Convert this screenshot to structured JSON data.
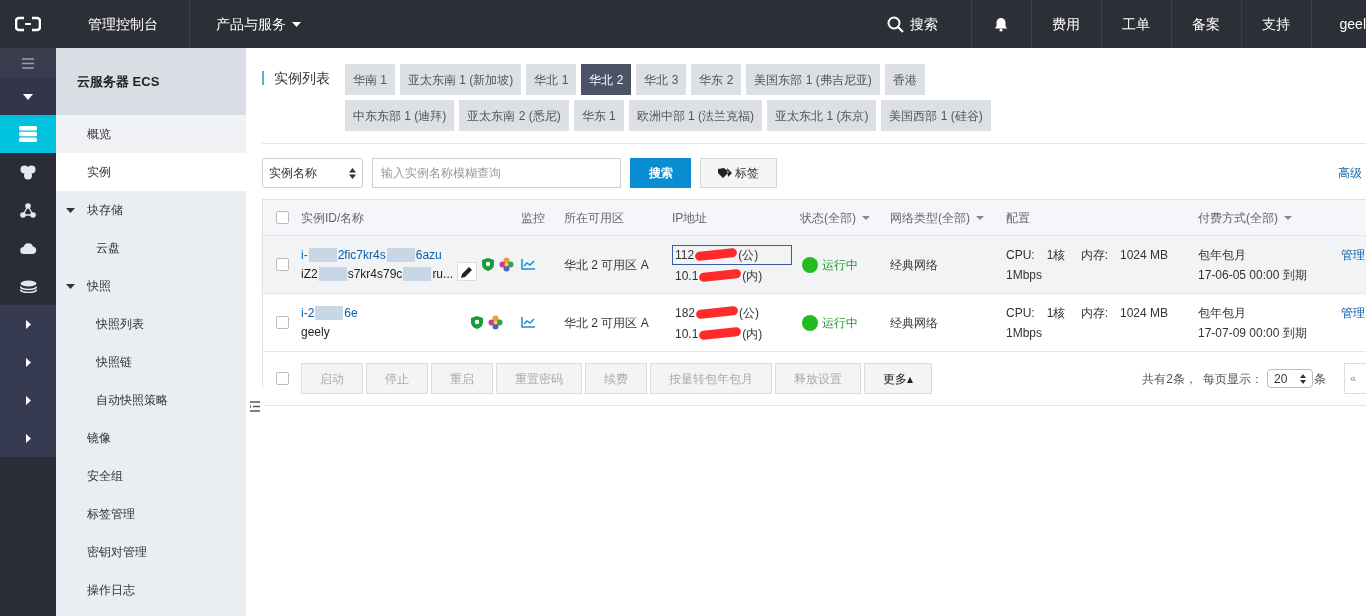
{
  "topbar": {
    "console": "管理控制台",
    "products": "产品与服务",
    "search": "搜索",
    "links": [
      "费用",
      "工单",
      "备案",
      "支持"
    ],
    "user": "geel"
  },
  "rail": {
    "items": [
      {
        "kind": "menu",
        "selected": false
      },
      {
        "kind": "collapse",
        "selected": false
      },
      {
        "kind": "servers",
        "selected": true
      },
      {
        "kind": "cluster",
        "selected": false
      },
      {
        "kind": "network",
        "selected": false
      },
      {
        "kind": "cloud",
        "selected": false
      },
      {
        "kind": "layers",
        "selected": false
      },
      {
        "kind": "expand",
        "selected": false
      },
      {
        "kind": "expand",
        "selected": false
      },
      {
        "kind": "expand",
        "selected": false
      },
      {
        "kind": "expand",
        "selected": false
      }
    ]
  },
  "sidebar": {
    "title": "云服务器 ECS",
    "items": [
      {
        "label": "概览",
        "selected": false
      },
      {
        "label": "实例",
        "selected": true
      },
      {
        "label": "块存储",
        "selected": false,
        "expanded": true,
        "children": [
          {
            "label": "云盘",
            "selected": false
          }
        ]
      },
      {
        "label": "快照",
        "selected": false,
        "expanded": true,
        "children": [
          {
            "label": "快照列表",
            "selected": false
          },
          {
            "label": "快照链",
            "selected": false
          },
          {
            "label": "自动快照策略",
            "selected": false
          }
        ]
      },
      {
        "label": "镜像",
        "selected": false
      },
      {
        "label": "安全组",
        "selected": false
      },
      {
        "label": "标签管理",
        "selected": false
      },
      {
        "label": "密钥对管理",
        "selected": false
      },
      {
        "label": "操作日志",
        "selected": false
      }
    ]
  },
  "page_title": "实例列表",
  "regions": [
    {
      "label": "华南 1",
      "selected": false
    },
    {
      "label": "亚太东南 1 (新加坡)",
      "selected": false
    },
    {
      "label": "华北 1",
      "selected": false
    },
    {
      "label": "华北 2",
      "selected": true
    },
    {
      "label": "华北 3",
      "selected": false
    },
    {
      "label": "华东 2",
      "selected": false
    },
    {
      "label": "美国东部 1 (弗吉尼亚)",
      "selected": false
    },
    {
      "label": "香港",
      "selected": false
    },
    {
      "label": "中东东部 1 (迪拜)",
      "selected": false
    },
    {
      "label": "亚太东南 2 (悉尼)",
      "selected": false
    },
    {
      "label": "华东 1",
      "selected": false
    },
    {
      "label": "欧洲中部 1 (法兰克福)",
      "selected": false
    },
    {
      "label": "亚太东北 1 (东京)",
      "selected": false
    },
    {
      "label": "美国西部 1 (硅谷)",
      "selected": false
    }
  ],
  "filter": {
    "select": "实例名称",
    "placeholder": "输入实例名称模糊查询",
    "search_button": "搜索",
    "tag_button": "标签",
    "advanced": "高级"
  },
  "table": {
    "select_all_checked": false,
    "columns": [
      {
        "label": "实例ID/名称",
        "filter": false
      },
      {
        "label": "监控",
        "filter": false
      },
      {
        "label": "所在可用区",
        "filter": false
      },
      {
        "label": "IP地址",
        "filter": false
      },
      {
        "label": "状态(全部)",
        "filter": true
      },
      {
        "label": "网络类型(全部)",
        "filter": true
      },
      {
        "label": "配置",
        "filter": false
      },
      {
        "label": "付费方式(全部)",
        "filter": true
      }
    ],
    "rows": [
      {
        "hovered": true,
        "checked": false,
        "id_parts": [
          "i-",
          "2fic7kr4s",
          "6azu"
        ],
        "name_parts": [
          "iZ2",
          "s7kr4s79c",
          "ru..."
        ],
        "edit_button": true,
        "zone": "华北 2 可用区 A",
        "public_ip": {
          "parts": [
            "112",
            "(公)"
          ],
          "outlined": true
        },
        "private_ip": {
          "parts": [
            "10.1",
            "(内)"
          ]
        },
        "status": "运行中",
        "network": "经典网络",
        "config_line1": "CPU:　1核　 内存:　1024 MB",
        "config_line2": "1Mbps",
        "billing": "包年包月",
        "expiry": "17-06-05 00:00 到期",
        "action": "管理"
      },
      {
        "hovered": false,
        "checked": false,
        "id_parts": [
          "i-2",
          "6e"
        ],
        "name_parts": [
          "geely"
        ],
        "edit_button": false,
        "zone": "华北 2 可用区 A",
        "public_ip": {
          "parts": [
            "182",
            "(公)"
          ],
          "outlined": false
        },
        "private_ip": {
          "parts": [
            "10.1",
            "(内)"
          ]
        },
        "status": "运行中",
        "network": "经典网络",
        "config_line1": "CPU:　1核　 内存:　1024 MB",
        "config_line2": "1Mbps",
        "billing": "包年包月",
        "expiry": "17-07-09 00:00 到期",
        "action": "管理"
      }
    ]
  },
  "footer": {
    "checked": false,
    "buttons": [
      {
        "label": "启动",
        "disabled": true
      },
      {
        "label": "停止",
        "disabled": true
      },
      {
        "label": "重启",
        "disabled": true
      },
      {
        "label": "重置密码",
        "disabled": true
      },
      {
        "label": "续费",
        "disabled": true
      },
      {
        "label": "按量转包年包月",
        "disabled": true
      },
      {
        "label": "释放设置",
        "disabled": true
      },
      {
        "label": "更多▴",
        "disabled": false
      }
    ],
    "total": "共有2条，",
    "per_page_label": "每页显示：",
    "per_page": "20",
    "unit": "条",
    "pager": "«"
  }
}
